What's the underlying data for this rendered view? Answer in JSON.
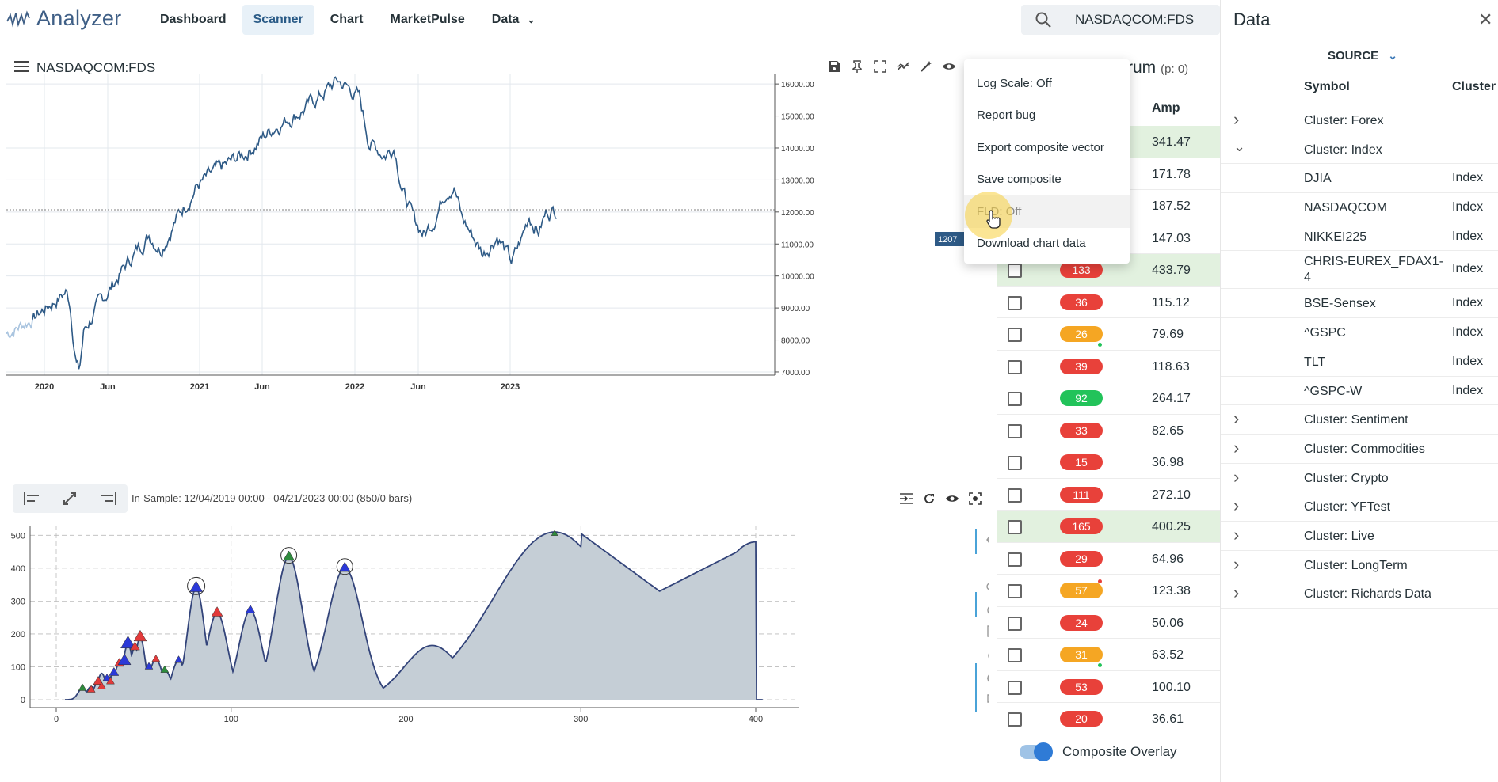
{
  "app": {
    "name": "Analyzer"
  },
  "nav": {
    "items": [
      {
        "label": "Dashboard"
      },
      {
        "label": "Scanner"
      },
      {
        "label": "Chart"
      },
      {
        "label": "MarketPulse"
      },
      {
        "label": "Data"
      }
    ],
    "active": "Scanner"
  },
  "search": {
    "value": "NASDAQCOM:FDS"
  },
  "chart": {
    "symbol": "NASDAQCOM:FDS",
    "last_price_label": "1207",
    "x_ticks": [
      "2020",
      "Jun",
      "2021",
      "Jun",
      "2022",
      "Jun",
      "2023"
    ],
    "y_ticks": [
      "16000.00",
      "15000.00",
      "14000.00",
      "13000.00",
      "12000.00",
      "11000.00",
      "10000.00",
      "9000.00",
      "8000.00",
      "7000.00"
    ],
    "line_color": "#2e5a86"
  },
  "range": {
    "text": "In-Sample: 12/04/2019 00:00 - 04/21/2023 00:00 (850/0 bars)"
  },
  "spectrum": {
    "x_ticks": [
      "0",
      "100",
      "200",
      "300",
      "400"
    ],
    "y_ticks": [
      "500",
      "400",
      "300",
      "200",
      "100",
      "0"
    ],
    "fill_color": "#c5ced6",
    "line_color": "#33447a"
  },
  "menu": {
    "items": [
      {
        "label": "Log Scale: Off"
      },
      {
        "label": "Report bug"
      },
      {
        "label": "Export composite vector"
      },
      {
        "label": "Save composite"
      },
      {
        "label": "FLD: Off"
      },
      {
        "label": "Download chart data"
      }
    ],
    "hovered": "FLD: Off"
  },
  "cycles": {
    "title": "rum",
    "count_label": "(p: 0)",
    "amp_header": "Amp",
    "rows": [
      {
        "period": "",
        "amp": "341.47",
        "highlight": true
      },
      {
        "period": "",
        "amp": "171.78"
      },
      {
        "period": "",
        "amp": "187.52"
      },
      {
        "period": "",
        "amp": "147.03"
      },
      {
        "period": "133",
        "color": "red",
        "amp": "433.79",
        "highlight": true
      },
      {
        "period": "36",
        "color": "red",
        "amp": "115.12"
      },
      {
        "period": "26",
        "color": "orange",
        "amp": "79.69",
        "dot": "g"
      },
      {
        "period": "39",
        "color": "red",
        "amp": "118.63"
      },
      {
        "period": "92",
        "color": "green",
        "amp": "264.17"
      },
      {
        "period": "33",
        "color": "red",
        "amp": "82.65"
      },
      {
        "period": "15",
        "color": "red",
        "amp": "36.98"
      },
      {
        "period": "111",
        "color": "red",
        "amp": "272.10"
      },
      {
        "period": "165",
        "color": "red",
        "amp": "400.25",
        "highlight": true
      },
      {
        "period": "29",
        "color": "red",
        "amp": "64.96"
      },
      {
        "period": "57",
        "color": "orange",
        "amp": "123.38",
        "dot": "r"
      },
      {
        "period": "24",
        "color": "red",
        "amp": "50.06"
      },
      {
        "period": "31",
        "color": "orange",
        "amp": "63.52",
        "dot": "g"
      },
      {
        "period": "53",
        "color": "red",
        "amp": "100.10"
      },
      {
        "period": "20",
        "color": "red",
        "amp": "36.61"
      }
    ],
    "overlay_label": "Composite Overlay"
  },
  "data_panel": {
    "title": "Data",
    "source_label": "SOURCE",
    "col_symbol": "Symbol",
    "col_cluster": "Cluster",
    "rows": [
      {
        "chev": "right",
        "symbol": "Cluster: Forex",
        "cluster": ""
      },
      {
        "chev": "down",
        "symbol": "Cluster: Index",
        "cluster": ""
      },
      {
        "chev": "",
        "symbol": "DJIA",
        "cluster": "Index"
      },
      {
        "chev": "",
        "symbol": "NASDAQCOM",
        "cluster": "Index"
      },
      {
        "chev": "",
        "symbol": "NIKKEI225",
        "cluster": "Index"
      },
      {
        "chev": "",
        "symbol": "CHRIS-EUREX_FDAX1-4",
        "cluster": "Index",
        "tall": true
      },
      {
        "chev": "",
        "symbol": "BSE-Sensex",
        "cluster": "Index"
      },
      {
        "chev": "",
        "symbol": "^GSPC",
        "cluster": "Index"
      },
      {
        "chev": "",
        "symbol": "TLT",
        "cluster": "Index"
      },
      {
        "chev": "",
        "symbol": "^GSPC-W",
        "cluster": "Index"
      },
      {
        "chev": "right",
        "symbol": "Cluster: Sentiment",
        "cluster": ""
      },
      {
        "chev": "right",
        "symbol": "Cluster: Commodities",
        "cluster": ""
      },
      {
        "chev": "right",
        "symbol": "Cluster: Crypto",
        "cluster": ""
      },
      {
        "chev": "right",
        "symbol": "Cluster: YFTest",
        "cluster": ""
      },
      {
        "chev": "right",
        "symbol": "Cluster: Live",
        "cluster": ""
      },
      {
        "chev": "right",
        "symbol": "Cluster: LongTerm",
        "cluster": ""
      },
      {
        "chev": "right",
        "symbol": "Cluster: Richards Data",
        "cluster": ""
      }
    ]
  }
}
